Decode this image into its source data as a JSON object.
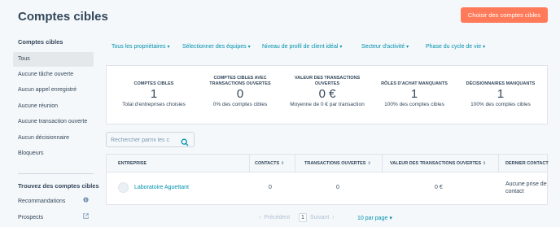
{
  "header": {
    "title": "Comptes cibles",
    "primary_button": "Choisir des comptes cibles"
  },
  "sidebar": {
    "heading": "Comptes cibles",
    "items": [
      {
        "label": "Tous",
        "active": true
      },
      {
        "label": "Aucune tâche ouverte"
      },
      {
        "label": "Aucun appel enregistré"
      },
      {
        "label": "Aucune réunion"
      },
      {
        "label": "Aucune transaction ouverte"
      },
      {
        "label": "Aucun décisionnaire"
      },
      {
        "label": "Bloqueurs"
      }
    ],
    "find_heading": "Trouvez des comptes cibles",
    "find_items": [
      {
        "label": "Recommandations",
        "icon": "info-icon"
      },
      {
        "label": "Prospects",
        "icon": "external-link-icon"
      }
    ]
  },
  "filters": [
    "Tous les propriétaires",
    "Sélectionner des équipes",
    "Niveau de profil de client idéal",
    "Secteur d'activité",
    "Phase du cycle de vie"
  ],
  "stats": [
    {
      "label": "Comptes cibles",
      "value": "1",
      "sub": "Total d'entreprises choisies"
    },
    {
      "label": "Comptes cibles avec transactions ouvertes",
      "value": "0",
      "sub": "0% des comptes cibles"
    },
    {
      "label": "Valeur des transactions ouvertes",
      "value": "0 €",
      "sub": "Moyenne de 0 € par transaction"
    },
    {
      "label": "Rôles d'achat manquants",
      "value": "1",
      "sub": "100% des comptes cibles"
    },
    {
      "label": "Décisionnaires manquants",
      "value": "1",
      "sub": "100% des comptes cibles"
    }
  ],
  "search": {
    "placeholder": "Rechercher parmi les c"
  },
  "table": {
    "columns": [
      "Entreprise",
      "Contacts",
      "Transactions ouvertes",
      "Valeur des transactions ouvertes",
      "Dernier contact"
    ],
    "rows": [
      {
        "company": "Laboratoire Aguettant",
        "contacts": "0",
        "open_deals": "0",
        "deal_value": "0 €",
        "last_contact_1": "Aucune prise de",
        "last_contact_2": "contact"
      }
    ]
  },
  "pagination": {
    "previous": "Précédent",
    "current_page": "1",
    "next": "Suivant",
    "per_page": "10 par page"
  },
  "colors": {
    "accent": "#ff7a59",
    "link": "#0091ae",
    "text": "#33475b"
  }
}
